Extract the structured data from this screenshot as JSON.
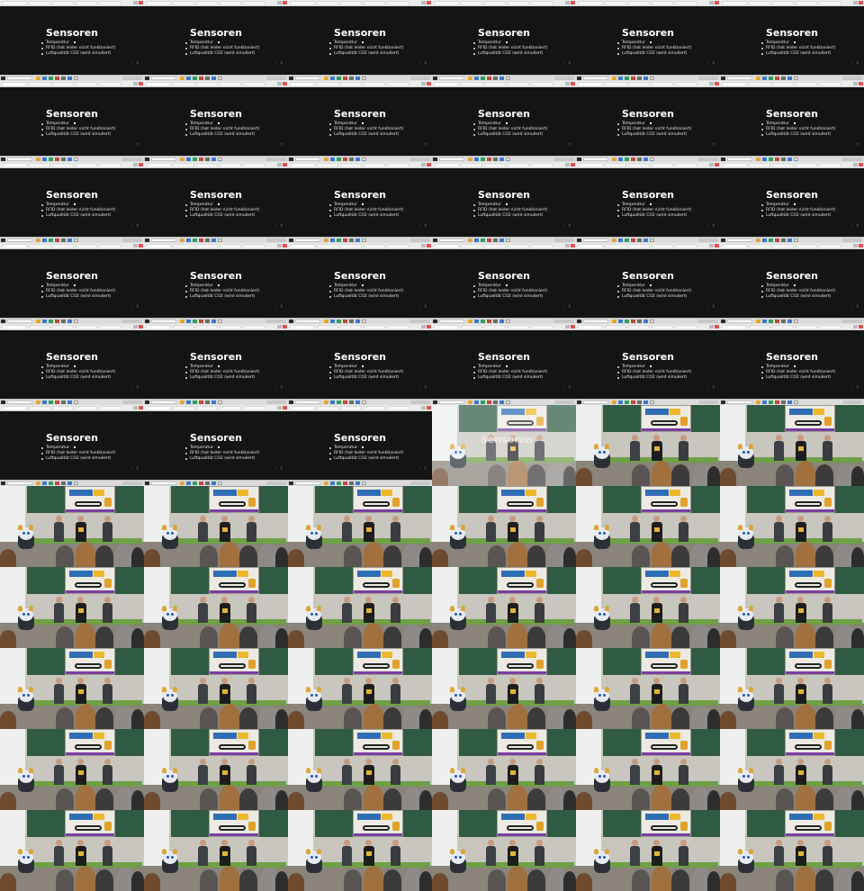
{
  "slide": {
    "title": "Sensoren",
    "bullets": [
      "Temperatur",
      "RFID (hat leider nicht funktioniert)",
      "Luftqualität CO2 (wird simuliert)"
    ]
  },
  "grid": {
    "columns": 6,
    "rows": 11,
    "slide_frames": 33,
    "transition_frames": 1,
    "photo_frames": 32
  },
  "colors": {
    "slide_background": "#141414",
    "slide_text": "#ffffff",
    "accent_arrow": "#4a9be0",
    "board_green": "#2f5a43",
    "desk_green": "#6fa046"
  },
  "icons": {
    "next": "chevron-right-icon",
    "prev": "chevron-left-icon"
  }
}
